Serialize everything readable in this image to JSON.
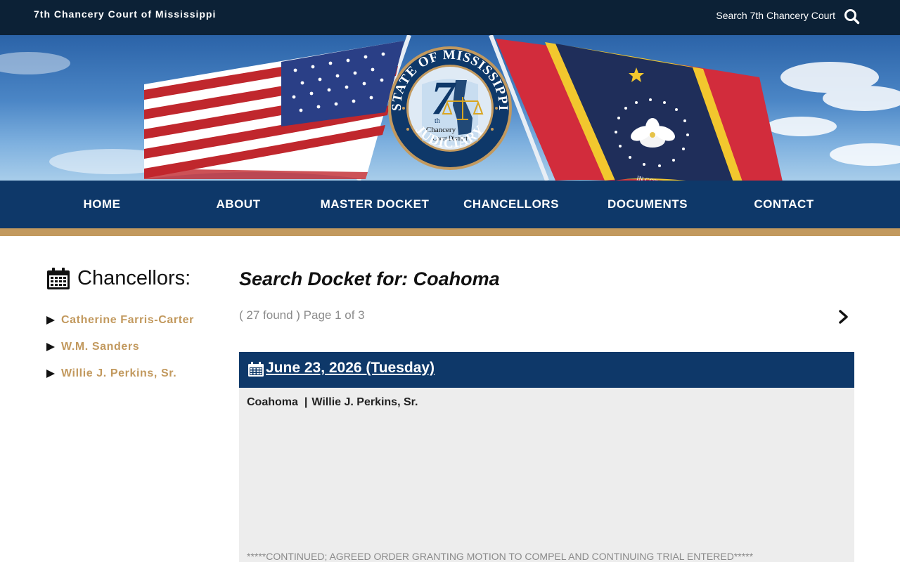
{
  "header": {
    "site_name": "7th Chancery Court of Mississippi",
    "search_label": "Search 7th Chancery Court",
    "search_icon": "search-icon"
  },
  "banner": {
    "seal_text_top": "STATE OF MISSISSIPPI",
    "seal_number": "7",
    "seal_superscript": "th",
    "seal_line1": "Chancery",
    "seal_line2": "Court District",
    "seal_text_bottom": "JUDICIARY",
    "flag_motto": "IN GOD WE TRUST"
  },
  "nav": {
    "items": [
      {
        "label": "HOME"
      },
      {
        "label": "ABOUT"
      },
      {
        "label": "MASTER DOCKET"
      },
      {
        "label": "CHANCELLORS"
      },
      {
        "label": "DOCUMENTS"
      },
      {
        "label": "CONTACT"
      }
    ]
  },
  "sidebar": {
    "heading": "Chancellors:",
    "items": [
      {
        "label": "Catherine Farris-Carter"
      },
      {
        "label": "W.M. Sanders"
      },
      {
        "label": "Willie J. Perkins, Sr."
      }
    ]
  },
  "main": {
    "title": "Search Docket for: Coahoma",
    "results_text": "( 27 found ) Page 1 of 3",
    "entries": [
      {
        "date": "June 23, 2026 (Tuesday)",
        "county": "Coahoma",
        "separator": "|",
        "chancellor": "Willie J. Perkins, Sr.",
        "note": "*****CONTINUED; AGREED ORDER GRANTING MOTION TO COMPEL AND CONTINUING TRIAL ENTERED*****"
      }
    ]
  },
  "colors": {
    "topbar": "#0c2136",
    "nav": "#0e3869",
    "accent_gold": "#c2995e",
    "card_bg": "#ededed"
  }
}
